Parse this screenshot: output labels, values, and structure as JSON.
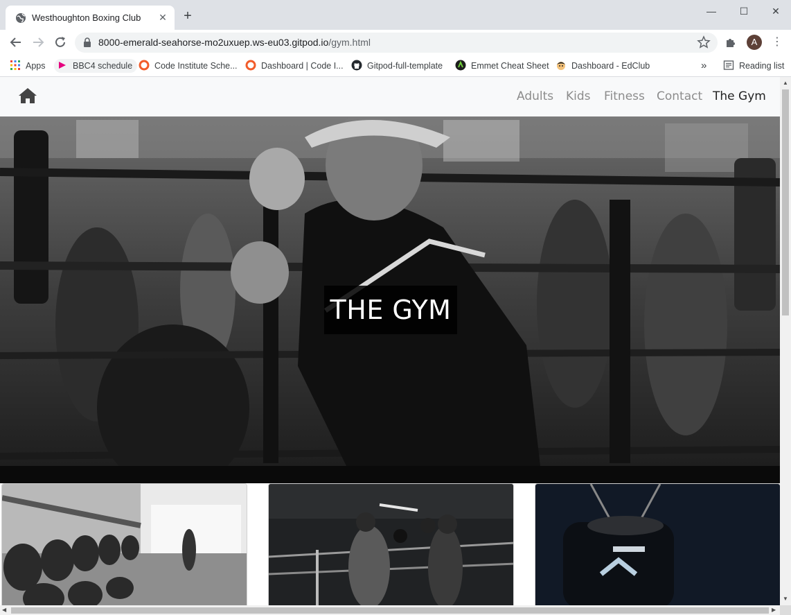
{
  "browser": {
    "tab_title": "Westhoughton Boxing Club",
    "url_host": "8000-emerald-seahorse-mo2uxuep.ws-eu03.gitpod.io",
    "url_path": "/gym.html",
    "profile_initial": "A",
    "bookmarks": [
      {
        "label": "Apps",
        "icon": "apps-grid-icon"
      },
      {
        "label": "BBC4 schedule",
        "icon": "bbc-icon"
      },
      {
        "label": "Code Institute Sche...",
        "icon": "code-institute-icon"
      },
      {
        "label": "Dashboard | Code I...",
        "icon": "code-institute-icon"
      },
      {
        "label": "Gitpod-full-template",
        "icon": "github-icon"
      },
      {
        "label": "Emmet Cheat Sheet",
        "icon": "emmet-icon"
      },
      {
        "label": "Dashboard - EdClub",
        "icon": "edclub-icon"
      }
    ],
    "reading_list": "Reading list",
    "overflow_label": "»"
  },
  "site": {
    "nav": {
      "links": [
        "Adults",
        "Kids",
        "Fitness",
        "Contact",
        "The Gym"
      ],
      "active_index": 4
    },
    "hero_title": "THE GYM"
  },
  "colors": {
    "tab_strip": "#dee1e6",
    "navbar": "#f8f9fa",
    "nav_link": "#8c8c8c",
    "nav_link_active": "#222222"
  }
}
